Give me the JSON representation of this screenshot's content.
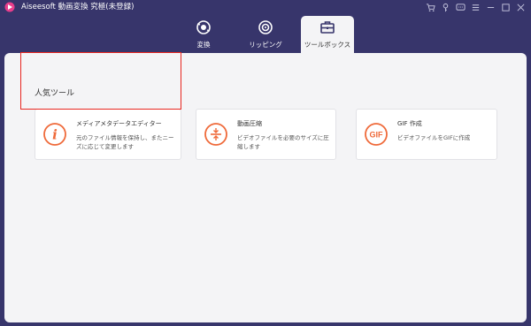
{
  "window": {
    "title": "Aiseesoft 動画変換 究極(未登録)",
    "controls": [
      "cart-icon",
      "key-icon",
      "feedback-icon",
      "menu-icon",
      "minimize-icon",
      "maximize-icon",
      "close-icon"
    ]
  },
  "tabs": [
    {
      "label": "変換",
      "icon": "convert-icon",
      "active": false
    },
    {
      "label": "リッピング",
      "icon": "ripping-icon",
      "active": false
    },
    {
      "label": "ツールボックス",
      "icon": "toolbox-icon",
      "active": true
    }
  ],
  "toolbox": {
    "section_title": "人気ツール",
    "tools": [
      {
        "title": "メディアメタデータエディター",
        "desc_line1": "元のファイル情報を保持し、またニー",
        "desc_line2": "ズに応じて変更します",
        "icon": "info-icon",
        "highlighted": true
      },
      {
        "title": "動画圧縮",
        "desc_line1": "ビデオファイルを必要のサイズに圧",
        "desc_line2": "縮します",
        "icon": "compress-icon",
        "highlighted": false
      },
      {
        "title": "GIF 作成",
        "desc_line1": "ビデオファイルをGIFに作成",
        "desc_line2": "",
        "icon": "gif-icon",
        "highlighted": false
      }
    ]
  },
  "colors": {
    "background": "#37356b",
    "accent": "#ef6a3a",
    "highlight": "#e8261f",
    "panel": "#f4f4f6"
  }
}
